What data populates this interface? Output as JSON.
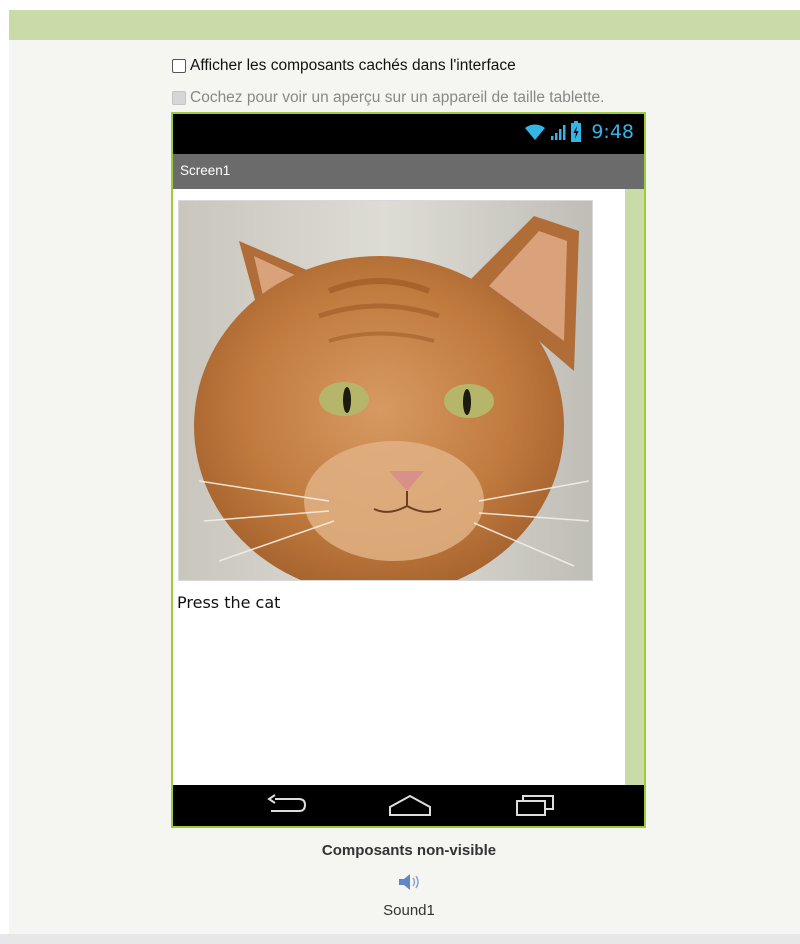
{
  "options": {
    "show_hidden_label": "Afficher les composants cachés dans l'interface",
    "show_hidden_checked": false,
    "tablet_preview_label": "Cochez pour voir un aperçu sur un appareil de taille tablette.",
    "tablet_preview_checked": false,
    "tablet_preview_disabled": true
  },
  "phone": {
    "status_bar": {
      "time": "9:48",
      "icons": [
        "wifi-icon",
        "signal-icon",
        "battery-icon"
      ]
    },
    "screen_title": "Screen1",
    "image": {
      "icon": "cat-photo"
    },
    "label_text": "Press the cat",
    "nav_buttons": [
      "back-icon",
      "home-icon",
      "recent-apps-icon"
    ]
  },
  "non_visible": {
    "title": "Composants non-visible",
    "components": [
      {
        "label": "Sound1",
        "icon": "sound-icon"
      }
    ]
  },
  "colors": {
    "accent_green": "#9ccc3c",
    "panel_green": "#c9dba7",
    "status_blue": "#34b5e5",
    "title_bar_gray": "#6b6b6b"
  }
}
